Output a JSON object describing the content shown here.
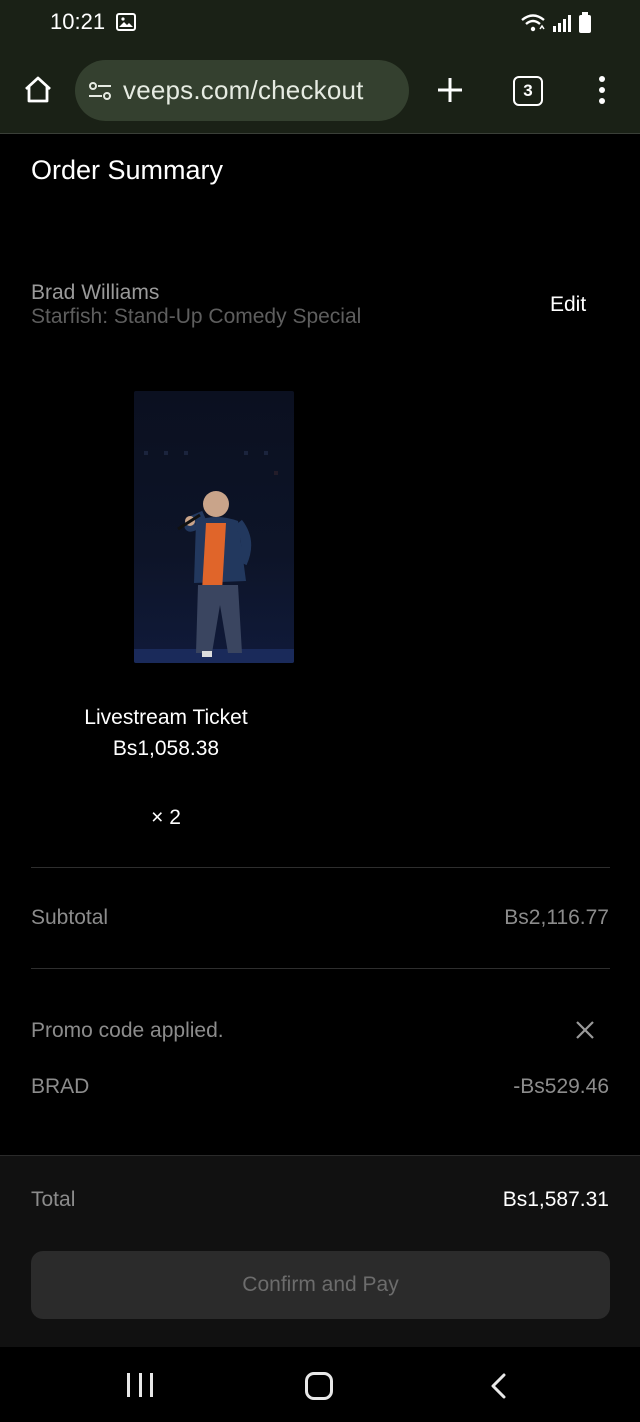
{
  "status_bar": {
    "time": "10:21",
    "icons": [
      "image-notification-icon",
      "wifi-icon",
      "signal-icon",
      "battery-icon"
    ]
  },
  "browser": {
    "url": "veeps.com/checkout",
    "tab_count": "3",
    "icons": [
      "home-icon",
      "site-settings-icon",
      "new-tab-icon",
      "tab-switcher-icon",
      "more-menu-icon"
    ]
  },
  "order": {
    "title": "Order Summary",
    "artist": "Brad Williams",
    "event": "Starfish: Stand-Up Comedy Special",
    "edit_label": "Edit",
    "item": {
      "name": "Livestream Ticket",
      "price": "Bs1,058.38",
      "quantity": "× 2"
    },
    "subtotal_label": "Subtotal",
    "subtotal_value": "Bs2,116.77",
    "promo_status": "Promo code applied.",
    "promo_code": "BRAD",
    "promo_discount": "-Bs529.46",
    "total_label": "Total",
    "total_value": "Bs1,587.31",
    "confirm_label": "Confirm and Pay"
  },
  "colors": {
    "browser_chrome": "#1a2116",
    "url_pill": "#34402f",
    "page_bg": "#000000",
    "footer_bg": "#111111",
    "button_disabled_bg": "#2b2b2b",
    "muted_text": "#8c8c8c"
  }
}
